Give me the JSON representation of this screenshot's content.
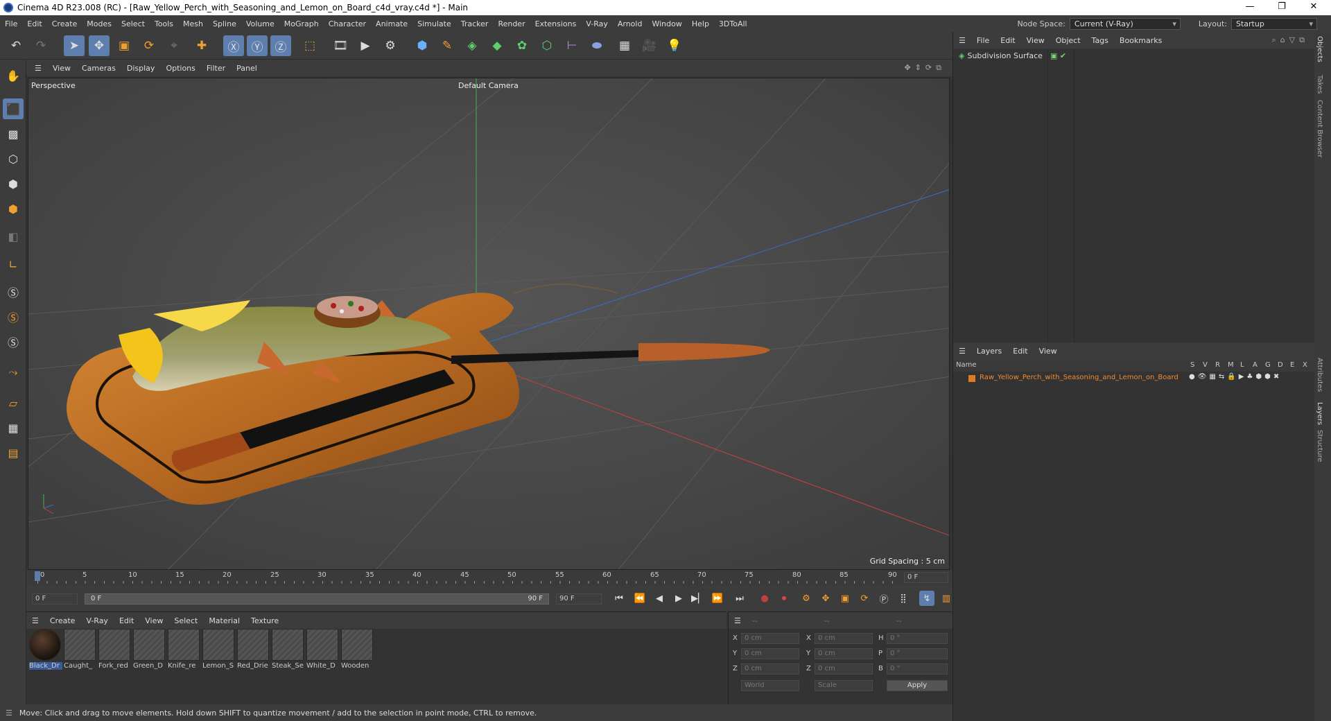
{
  "window": {
    "title": "Cinema 4D R23.008 (RC) - [Raw_Yellow_Perch_with_Seasoning_and_Lemon_on_Board_c4d_vray.c4d *] - Main"
  },
  "menubar": {
    "items": [
      "File",
      "Edit",
      "Create",
      "Modes",
      "Select",
      "Tools",
      "Mesh",
      "Spline",
      "Volume",
      "MoGraph",
      "Character",
      "Animate",
      "Simulate",
      "Tracker",
      "Render",
      "Extensions",
      "V-Ray",
      "Arnold",
      "Window",
      "Help",
      "3DToAll"
    ],
    "node_space_label": "Node Space:",
    "node_space_value": "Current (V-Ray)",
    "layout_label": "Layout:",
    "layout_value": "Startup"
  },
  "viewport": {
    "menu": [
      "View",
      "Cameras",
      "Display",
      "Options",
      "Filter",
      "Panel"
    ],
    "view_name": "Perspective",
    "camera": "Default Camera",
    "grid_spacing": "Grid Spacing : 5 cm"
  },
  "object_manager": {
    "menu": [
      "File",
      "Edit",
      "View",
      "Object",
      "Tags",
      "Bookmarks"
    ],
    "objects": [
      {
        "name": "Subdivision Surface"
      }
    ]
  },
  "layers": {
    "menu": [
      "Layers",
      "Edit",
      "View"
    ],
    "columns": {
      "name": "Name",
      "flags": [
        "S",
        "V",
        "R",
        "M",
        "L",
        "A",
        "G",
        "D",
        "E",
        "X"
      ]
    },
    "rows": [
      {
        "name": "Raw_Yellow_Perch_with_Seasoning_and_Lemon_on_Board",
        "color": "#e07a20"
      }
    ]
  },
  "side_tabs": [
    "Objects",
    "Takes",
    "Content Browser",
    "Attributes",
    "Layers",
    "Structure"
  ],
  "timeline": {
    "ticks": [
      "0",
      "5",
      "10",
      "15",
      "20",
      "25",
      "30",
      "35",
      "40",
      "45",
      "50",
      "55",
      "60",
      "65",
      "70",
      "75",
      "80",
      "85",
      "90"
    ],
    "current_frame_right": "0 F",
    "start_frame": "0 F",
    "slider_start": "0 F",
    "slider_end": "90 F",
    "end_frame": "90 F"
  },
  "materials": {
    "menu": [
      "Create",
      "V-Ray",
      "Edit",
      "View",
      "Select",
      "Material",
      "Texture"
    ],
    "items": [
      "Black_Dr",
      "Caught_",
      "Fork_red",
      "Green_D",
      "Knife_re",
      "Lemon_S",
      "Red_Drie",
      "Steak_Se",
      "White_D",
      "Wooden"
    ]
  },
  "coordinates": {
    "header": [
      "--",
      "--",
      "--"
    ],
    "rows": [
      {
        "axis": "X",
        "pos": "0 cm",
        "axis2": "X",
        "size": "0 cm",
        "axis3": "H",
        "rot": "0 °"
      },
      {
        "axis": "Y",
        "pos": "0 cm",
        "axis2": "Y",
        "size": "0 cm",
        "axis3": "P",
        "rot": "0 °"
      },
      {
        "axis": "Z",
        "pos": "0 cm",
        "axis2": "Z",
        "size": "0 cm",
        "axis3": "B",
        "rot": "0 °"
      }
    ],
    "mode1": "World",
    "mode2": "Scale",
    "apply": "Apply"
  },
  "status": "Move: Click and drag to move elements. Hold down SHIFT to quantize movement / add to the selection in point mode, CTRL to remove."
}
